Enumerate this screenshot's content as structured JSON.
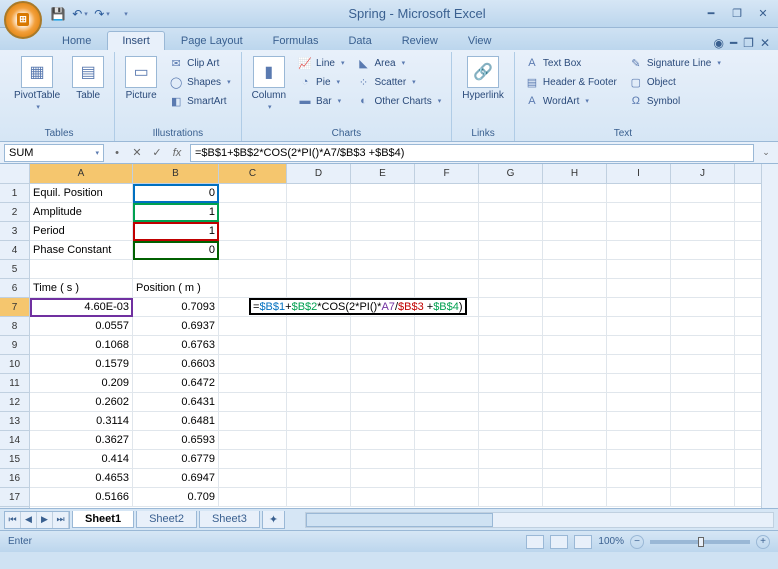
{
  "title": "Spring - Microsoft Excel",
  "tabs": [
    "Home",
    "Insert",
    "Page Layout",
    "Formulas",
    "Data",
    "Review",
    "View"
  ],
  "activeTab": 1,
  "ribbon": {
    "tables": {
      "label": "Tables",
      "pivot": "PivotTable",
      "table": "Table"
    },
    "illustrations": {
      "label": "Illustrations",
      "picture": "Picture",
      "clipart": "Clip Art",
      "shapes": "Shapes",
      "smartart": "SmartArt"
    },
    "charts": {
      "label": "Charts",
      "column": "Column",
      "line": "Line",
      "pie": "Pie",
      "bar": "Bar",
      "area": "Area",
      "scatter": "Scatter",
      "other": "Other Charts"
    },
    "links": {
      "label": "Links",
      "hyperlink": "Hyperlink"
    },
    "text": {
      "label": "Text",
      "textbox": "Text Box",
      "headerfooter": "Header & Footer",
      "wordart": "WordArt",
      "sigline": "Signature Line",
      "object": "Object",
      "symbol": "Symbol"
    }
  },
  "nameBox": "SUM",
  "formula": "=$B$1+$B$2*COS(2*PI()*A7/$B$3 +$B$4)",
  "columns": [
    "A",
    "B",
    "C",
    "D",
    "E",
    "F",
    "G",
    "H",
    "I",
    "J"
  ],
  "rows": [
    1,
    2,
    3,
    4,
    5,
    6,
    7,
    8,
    9,
    10,
    11,
    12,
    13,
    14,
    15,
    16,
    17
  ],
  "cells": {
    "A1": "Equil. Position",
    "B1": "0",
    "A2": "Amplitude",
    "B2": "1",
    "A3": "Period",
    "B3": "1",
    "A4": "Phase Constant",
    "B4": "0",
    "A6": "Time ( s )",
    "B6": "Position ( m )",
    "A7": "4.60E-03",
    "B7": "0.7093",
    "A8": "0.0557",
    "B8": "0.6937",
    "A9": "0.1068",
    "B9": "0.6763",
    "A10": "0.1579",
    "B10": "0.6603",
    "A11": "0.209",
    "B11": "0.6472",
    "A12": "0.2602",
    "B12": "0.6431",
    "A13": "0.3114",
    "B13": "0.6481",
    "A14": "0.3627",
    "B14": "0.6593",
    "A15": "0.414",
    "B15": "0.6779",
    "A16": "0.4653",
    "B16": "0.6947",
    "A17": "0.5166",
    "B17": "0.709"
  },
  "editFormula": {
    "p1": "=",
    "b1": "$B$1",
    "p2": "+",
    "b2": "$B$2",
    "p3": "*COS(2*PI()*",
    "a7": "A7",
    "p4": "/",
    "b3": "$B$3",
    "p5": " +",
    "b4": "$B$4",
    "p6": ")"
  },
  "sheetTabs": [
    "Sheet1",
    "Sheet2",
    "Sheet3"
  ],
  "activeSheet": 0,
  "status": "Enter",
  "zoom": "100%"
}
